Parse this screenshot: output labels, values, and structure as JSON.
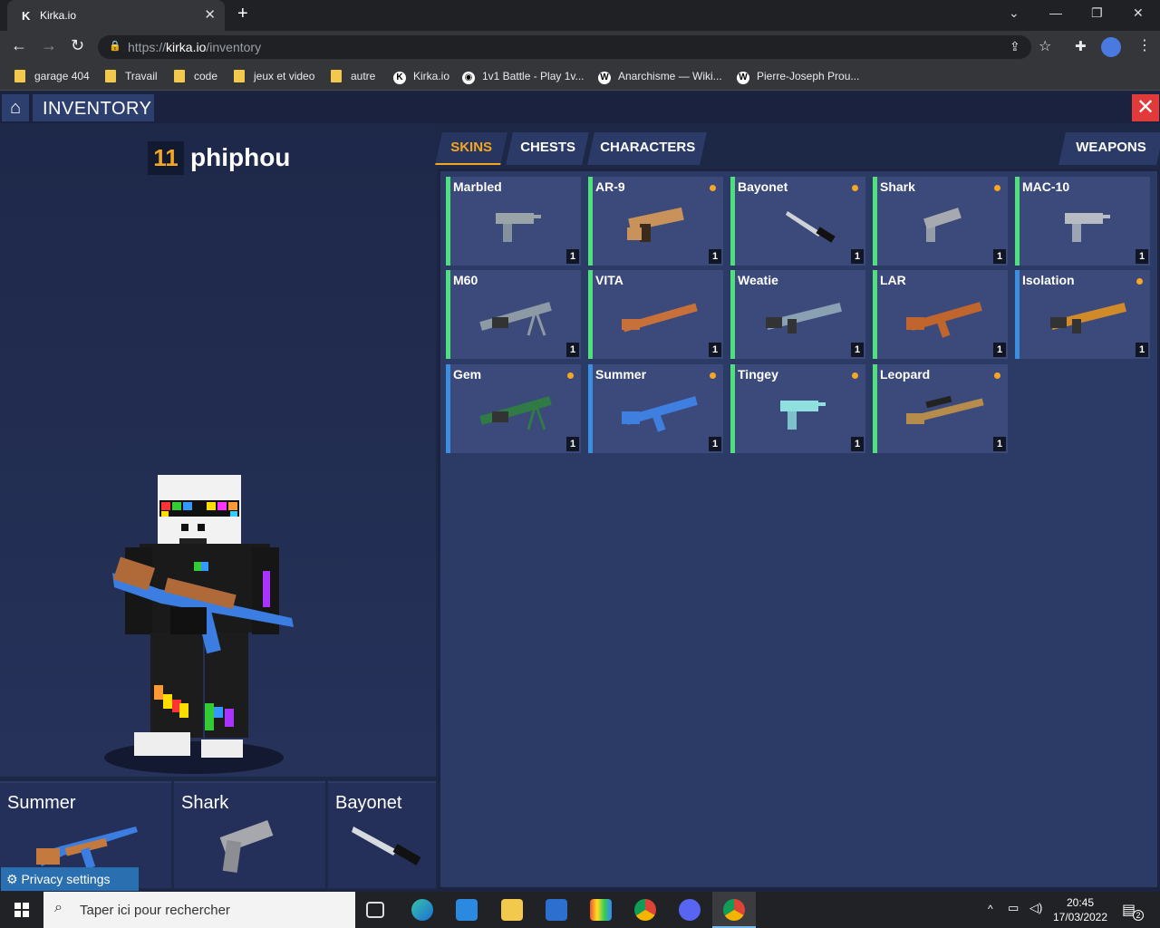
{
  "browser": {
    "tab_title": "Kirka.io",
    "tab_favicon": "K",
    "url_prefix": "https://",
    "url_domain": "kirka.io",
    "url_path": "/inventory",
    "bookmarks": [
      {
        "label": "garage 404",
        "icon": "folder-icon"
      },
      {
        "label": "Travail",
        "icon": "folder-icon"
      },
      {
        "label": "code",
        "icon": "folder-icon"
      },
      {
        "label": "jeux et video",
        "icon": "folder-icon"
      },
      {
        "label": "autre",
        "icon": "folder-icon"
      },
      {
        "label": "Kirka.io",
        "icon": "kirka-icon"
      },
      {
        "label": "1v1 Battle - Play 1v...",
        "icon": "battle-icon"
      },
      {
        "label": "Anarchisme — Wiki...",
        "icon": "wikipedia-icon"
      },
      {
        "label": "Pierre-Joseph Prou...",
        "icon": "wikipedia-icon"
      }
    ]
  },
  "game": {
    "title": "INVENTORY",
    "player": {
      "level": "11",
      "name": "phiphou"
    },
    "tabs": [
      "SKINS",
      "CHESTS",
      "CHARACTERS",
      "WEAPONS"
    ],
    "active_tab": "SKINS",
    "equipped": [
      {
        "name": "Summer"
      },
      {
        "name": "Shark"
      },
      {
        "name": "Bayonet"
      }
    ],
    "privacy_label": "Privacy settings",
    "skins": [
      {
        "name": "Marbled",
        "qty": "1",
        "rarity": "green",
        "new": false,
        "weapon": "smg",
        "color": "#9aa3a8"
      },
      {
        "name": "AR-9",
        "qty": "1",
        "rarity": "green",
        "new": true,
        "weapon": "smg-large",
        "color": "#c9925a"
      },
      {
        "name": "Bayonet",
        "qty": "1",
        "rarity": "green",
        "new": true,
        "weapon": "knife",
        "color": "#cfd3d8"
      },
      {
        "name": "Shark",
        "qty": "1",
        "rarity": "green",
        "new": true,
        "weapon": "pistol",
        "color": "#a7a9b0"
      },
      {
        "name": "MAC-10",
        "qty": "1",
        "rarity": "green",
        "new": false,
        "weapon": "smg",
        "color": "#b7bcc4"
      },
      {
        "name": "M60",
        "qty": "1",
        "rarity": "green",
        "new": false,
        "weapon": "lmg",
        "color": "#8d9aa6"
      },
      {
        "name": "VITA",
        "qty": "1",
        "rarity": "green",
        "new": false,
        "weapon": "shotgun",
        "color": "#c8703a"
      },
      {
        "name": "Weatie",
        "qty": "1",
        "rarity": "green",
        "new": false,
        "weapon": "rifle",
        "color": "#8aa0b3"
      },
      {
        "name": "LAR",
        "qty": "1",
        "rarity": "green",
        "new": false,
        "weapon": "ak",
        "color": "#c0652e"
      },
      {
        "name": "Isolation",
        "qty": "1",
        "rarity": "blue",
        "new": true,
        "weapon": "rifle",
        "color": "#d18a2a"
      },
      {
        "name": "Gem",
        "qty": "1",
        "rarity": "blue",
        "new": true,
        "weapon": "lmg",
        "color": "#2f7a45"
      },
      {
        "name": "Summer",
        "qty": "1",
        "rarity": "blue",
        "new": true,
        "weapon": "ak",
        "color": "#3f7fe0"
      },
      {
        "name": "Tingey",
        "qty": "1",
        "rarity": "green",
        "new": true,
        "weapon": "smg",
        "color": "#8fe0df"
      },
      {
        "name": "Leopard",
        "qty": "1",
        "rarity": "green",
        "new": true,
        "weapon": "sniper",
        "color": "#b58c4c"
      }
    ]
  },
  "taskbar": {
    "search_placeholder": "Taper ici pour rechercher",
    "time": "20:45",
    "date": "17/03/2022",
    "notifications": "2"
  }
}
